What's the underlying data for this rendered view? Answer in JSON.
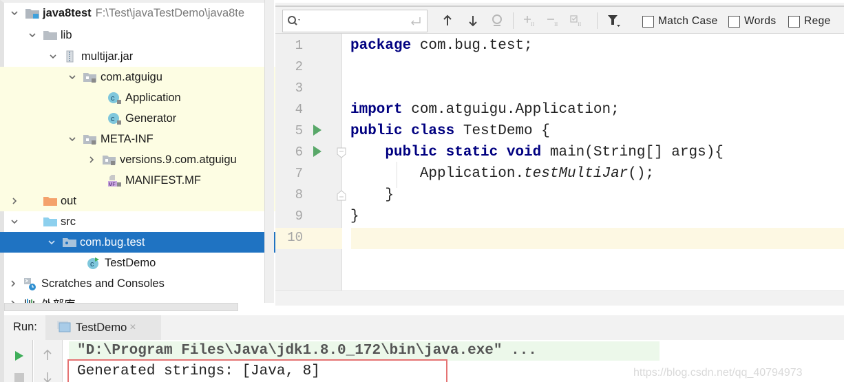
{
  "project_tree": {
    "items": [
      {
        "label": "java8test",
        "path": "F:\\Test\\javaTestDemo\\java8te",
        "expanded": true,
        "icon": "module-folder-icon"
      },
      {
        "label": "lib",
        "expanded": true,
        "icon": "folder-icon"
      },
      {
        "label": "multijar.jar",
        "expanded": true,
        "icon": "jar-icon"
      },
      {
        "label": "com.atguigu",
        "expanded": true,
        "icon": "package-locked-icon"
      },
      {
        "label": "Application",
        "icon": "class-locked-icon"
      },
      {
        "label": "Generator",
        "icon": "class-locked-icon"
      },
      {
        "label": "META-INF",
        "expanded": true,
        "icon": "package-locked-icon"
      },
      {
        "label": "versions.9.com.atguigu",
        "expanded": false,
        "icon": "package-locked-icon"
      },
      {
        "label": "MANIFEST.MF",
        "icon": "manifest-icon"
      },
      {
        "label": "out",
        "expanded": false,
        "icon": "excluded-folder-icon"
      },
      {
        "label": "src",
        "expanded": true,
        "icon": "source-folder-icon"
      },
      {
        "label": "com.bug.test",
        "expanded": true,
        "selected": true,
        "icon": "package-icon"
      },
      {
        "label": "TestDemo",
        "icon": "runnable-class-icon"
      },
      {
        "label": "Scratches and Consoles",
        "expanded": false,
        "icon": "scratches-icon"
      },
      {
        "label": "外部库",
        "expanded": false,
        "icon": "libraries-icon"
      }
    ]
  },
  "search": {
    "value": "",
    "options": [
      {
        "label": "Match Case",
        "checked": false
      },
      {
        "label": "Words",
        "checked": false
      },
      {
        "label": "Rege",
        "checked": false
      }
    ]
  },
  "editor": {
    "line_numbers": [
      "1",
      "2",
      "3",
      "4",
      "5",
      "6",
      "7",
      "8",
      "9",
      "10"
    ],
    "current_line": 10,
    "lines": [
      [
        {
          "t": "package",
          "k": "kw"
        },
        {
          "t": " com.bug.test;"
        }
      ],
      [],
      [],
      [
        {
          "t": "import",
          "k": "kw"
        },
        {
          "t": " com.atguigu.Application;"
        }
      ],
      [
        {
          "t": "public class",
          "k": "kw"
        },
        {
          "t": " TestDemo {"
        }
      ],
      [
        {
          "t": "    "
        },
        {
          "t": "public static void",
          "k": "kw"
        },
        {
          "t": " main(String[] args){"
        }
      ],
      [
        {
          "t": "        Application."
        },
        {
          "t": "testMultiJar",
          "k": "it"
        },
        {
          "t": "();"
        }
      ],
      [
        {
          "t": "    }"
        }
      ],
      [
        {
          "t": "}"
        }
      ],
      []
    ]
  },
  "run_panel": {
    "label": "Run:",
    "tab_label": "TestDemo",
    "command": "\"D:\\Program Files\\Java\\jdk1.8.0_172\\bin\\java.exe\" ...",
    "output": "Generated strings: [Java, 8]"
  },
  "watermark": "https://blog.csdn.net/qq_40794973",
  "colors": {
    "selection": "#1f73c2",
    "library_bg": "#fdfde3",
    "keyword": "#000080",
    "run_green": "#59a869",
    "current_line": "#fdf8e3",
    "output_highlight_border": "#e57373"
  }
}
